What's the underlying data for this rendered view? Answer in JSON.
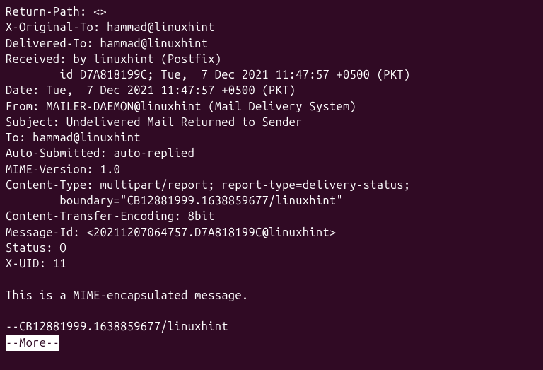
{
  "email": {
    "return_path": "Return-Path: <>",
    "x_original_to": "X-Original-To: hammad@linuxhint",
    "delivered_to": "Delivered-To: hammad@linuxhint",
    "received_line1": "Received: by linuxhint (Postfix)",
    "received_line2": "        id D7A818199C; Tue,  7 Dec 2021 11:47:57 +0500 (PKT)",
    "date": "Date: Tue,  7 Dec 2021 11:47:57 +0500 (PKT)",
    "from": "From: MAILER-DAEMON@linuxhint (Mail Delivery System)",
    "subject": "Subject: Undelivered Mail Returned to Sender",
    "to": "To: hammad@linuxhint",
    "auto_submitted": "Auto-Submitted: auto-replied",
    "mime_version": "MIME-Version: 1.0",
    "content_type_line1": "Content-Type: multipart/report; report-type=delivery-status;",
    "content_type_line2": "        boundary=\"CB12881999.1638859677/linuxhint\"",
    "content_transfer_encoding": "Content-Transfer-Encoding: 8bit",
    "message_id": "Message-Id: <20211207064757.D7A818199C@linuxhint>",
    "status": "Status: O",
    "x_uid": "X-UID: 11",
    "blank": "",
    "body1": "This is a MIME-encapsulated message.",
    "blank2": "",
    "boundary_marker": "--CB12881999.1638859677/linuxhint"
  },
  "pager": {
    "prompt": "--More--"
  }
}
